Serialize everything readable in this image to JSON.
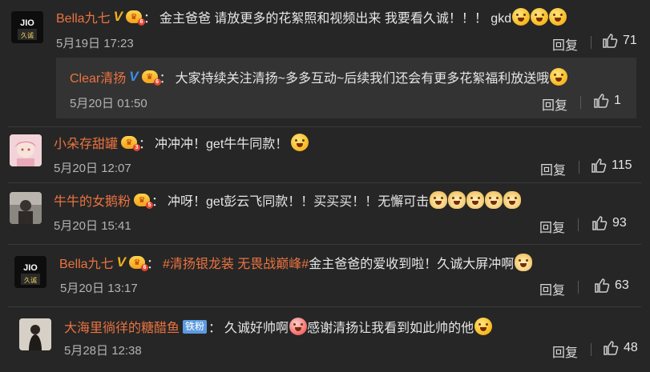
{
  "comments": [
    {
      "user": "Bella九七",
      "verified": true,
      "level": "6",
      "text": "金主爸爸 请放更多的花絮照和视频出来 我要看久诚！！！ gkd",
      "emoji_count": 3,
      "time": "5月19日 17:23",
      "reply_label": "回复",
      "likes": "71",
      "sub_reply": {
        "user": "Clear清扬",
        "verified": true,
        "level": "6",
        "text": "大家持续关注清扬~多多互动~后续我们还会有更多花絮福利放送哦",
        "time": "5月20日 01:50",
        "reply_label": "回复",
        "likes": "1"
      }
    },
    {
      "user": "小朵存甜罐",
      "level": "3",
      "text": "冲冲冲！get牛牛同款！",
      "time": "5月20日 12:07",
      "reply_label": "回复",
      "likes": "115"
    },
    {
      "user": "牛牛的女鹅粉",
      "level": "5",
      "text": "冲呀！get彭云飞同款！！买买买！！无懈可击",
      "time": "5月20日 15:41",
      "reply_label": "回复",
      "likes": "93"
    },
    {
      "user": "Bella九七",
      "verified": true,
      "level": "6",
      "topic": "#清扬银龙装 无畏战巅峰#",
      "text": " 金主爸爸的爱收到啦！久诚大屏冲啊",
      "time": "5月20日 13:17",
      "reply_label": "回复",
      "likes": "63"
    },
    {
      "user": "大海里徜徉的糖醋鱼",
      "badge": "铁粉",
      "text_a": "久诚好帅啊",
      "text_b": "感谢清扬让我看到如此帅的他",
      "time": "5月28日 12:38",
      "reply_label": "回复",
      "likes": "48"
    }
  ],
  "colors": {
    "background": "#262626",
    "username": "#eb7340",
    "verified_v": "#f3b11b",
    "verified_v_blue": "#3b8ee8",
    "badge": "#5d9be0"
  }
}
